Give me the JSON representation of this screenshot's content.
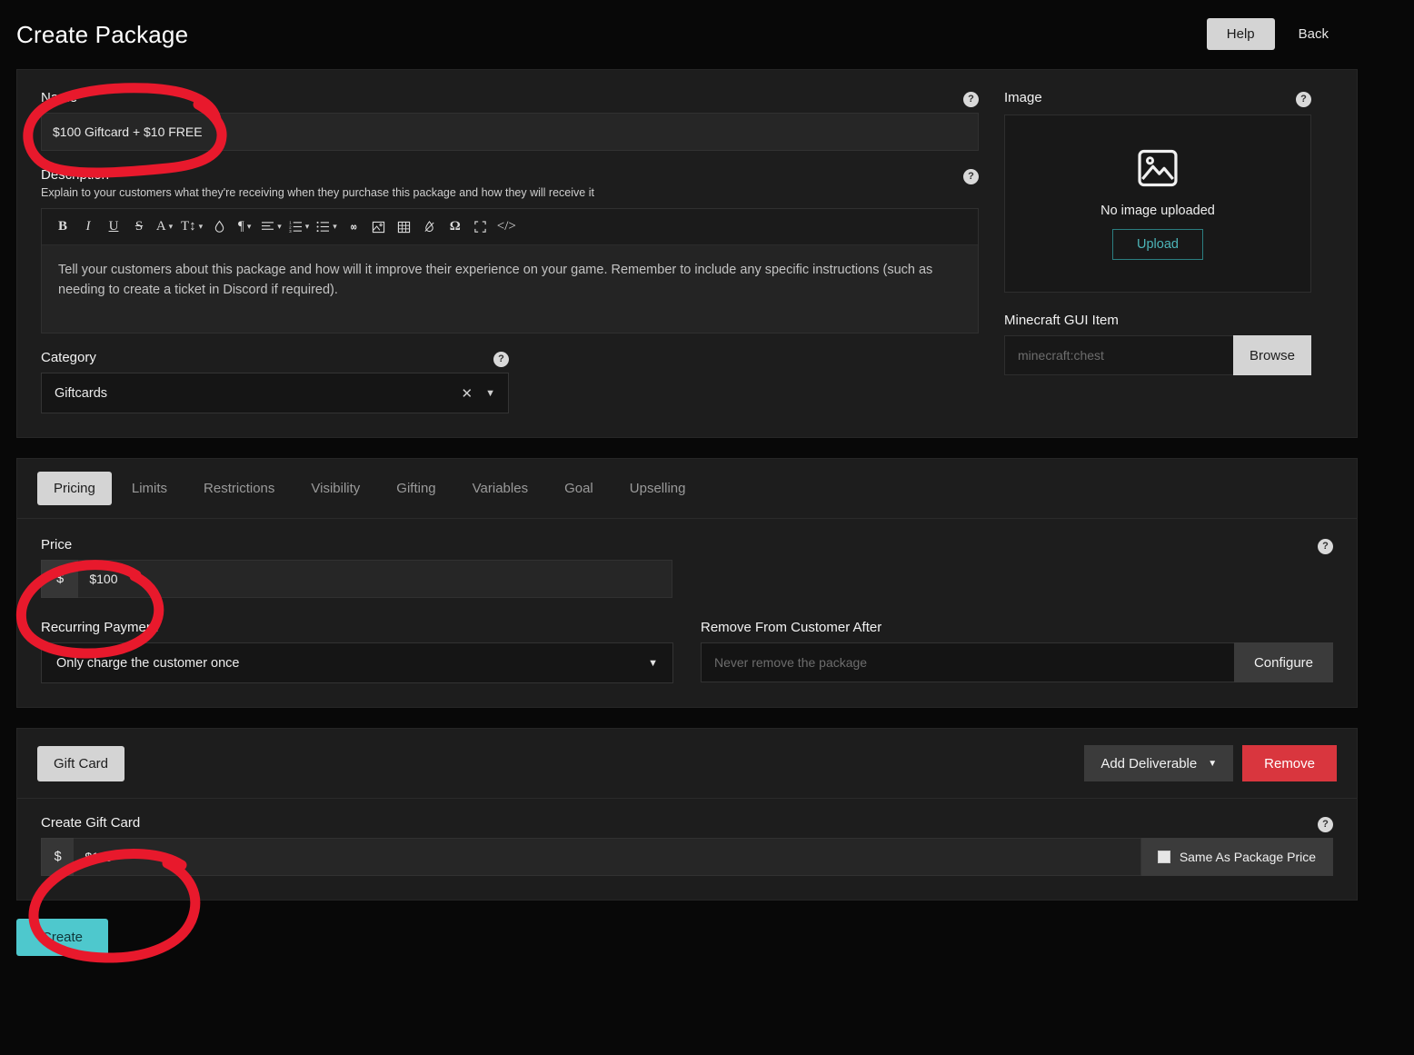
{
  "header": {
    "title": "Create Package",
    "help_label": "Help",
    "back_label": "Back"
  },
  "details": {
    "name": {
      "label": "Name",
      "value": "$100 Giftcard + $10 FREE",
      "help_icon": "question-mark-icon"
    },
    "description": {
      "label": "Description",
      "hint": "Explain to your customers what they're receiving when they purchase this package and how they will receive it",
      "placeholder": "Tell your customers about this package and how will it improve their experience on your game. Remember to include any specific instructions (such as needing to create a ticket in Discord if required).",
      "help_icon": "question-mark-icon",
      "toolbar": [
        {
          "name": "bold-icon",
          "glyph": "B"
        },
        {
          "name": "italic-icon",
          "glyph": "I"
        },
        {
          "name": "underline-icon",
          "glyph": "U"
        },
        {
          "name": "strikethrough-icon",
          "glyph": "S"
        },
        {
          "name": "font-color-icon",
          "glyph": "A"
        },
        {
          "name": "font-size-icon",
          "glyph": "T"
        },
        {
          "name": "highlight-color-icon",
          "glyph": "drop"
        },
        {
          "name": "paragraph-icon",
          "glyph": "¶"
        },
        {
          "name": "align-icon",
          "glyph": "align"
        },
        {
          "name": "ordered-list-icon",
          "glyph": "ol"
        },
        {
          "name": "unordered-list-icon",
          "glyph": "ul"
        },
        {
          "name": "link-icon",
          "glyph": "link"
        },
        {
          "name": "insert-image-icon",
          "glyph": "image"
        },
        {
          "name": "table-icon",
          "glyph": "table"
        },
        {
          "name": "clear-formatting-icon",
          "glyph": "eraser"
        },
        {
          "name": "special-character-icon",
          "glyph": "Ω"
        },
        {
          "name": "fullscreen-icon",
          "glyph": "expand"
        },
        {
          "name": "code-view-icon",
          "glyph": "</>"
        }
      ]
    },
    "category": {
      "label": "Category",
      "value": "Giftcards",
      "clear_icon": "close-icon",
      "caret_icon": "chevron-down-icon",
      "help_icon": "question-mark-icon"
    },
    "image": {
      "label": "Image",
      "empty_text": "No image uploaded",
      "upload_label": "Upload",
      "placeholder_icon": "image-placeholder-icon",
      "help_icon": "question-mark-icon"
    },
    "gui_item": {
      "label": "Minecraft GUI Item",
      "placeholder": "minecraft:chest",
      "value": "",
      "browse_label": "Browse"
    }
  },
  "tabs": [
    {
      "label": "Pricing",
      "active": true
    },
    {
      "label": "Limits",
      "active": false
    },
    {
      "label": "Restrictions",
      "active": false
    },
    {
      "label": "Visibility",
      "active": false
    },
    {
      "label": "Gifting",
      "active": false
    },
    {
      "label": "Variables",
      "active": false
    },
    {
      "label": "Goal",
      "active": false
    },
    {
      "label": "Upselling",
      "active": false
    }
  ],
  "pricing": {
    "price": {
      "label": "Price",
      "currency_prefix": "$",
      "value": "$100",
      "help_icon": "question-mark-icon"
    },
    "recurring": {
      "label": "Recurring Payment",
      "value": "Only charge the customer once",
      "caret_icon": "chevron-down-icon"
    },
    "remove_after": {
      "label": "Remove From Customer After",
      "placeholder": "Never remove the package",
      "value": "",
      "configure_label": "Configure"
    }
  },
  "deliverable": {
    "tab_label": "Gift Card",
    "add_label": "Add Deliverable",
    "add_caret_icon": "chevron-down-icon",
    "remove_label": "Remove",
    "gift_card": {
      "label": "Create Gift Card",
      "currency_prefix": "$",
      "value": "$110",
      "same_as_label": "Same As Package Price",
      "same_as_checked": false,
      "help_icon": "question-mark-icon"
    }
  },
  "footer": {
    "create_label": "Create"
  },
  "annotations": {
    "color": "#e8192c",
    "marks": [
      {
        "name": "annotation-circle-name",
        "target": "name-field"
      },
      {
        "name": "annotation-circle-price",
        "target": "price-field"
      },
      {
        "name": "annotation-circle-gift-card",
        "target": "gift-card-field"
      }
    ]
  }
}
